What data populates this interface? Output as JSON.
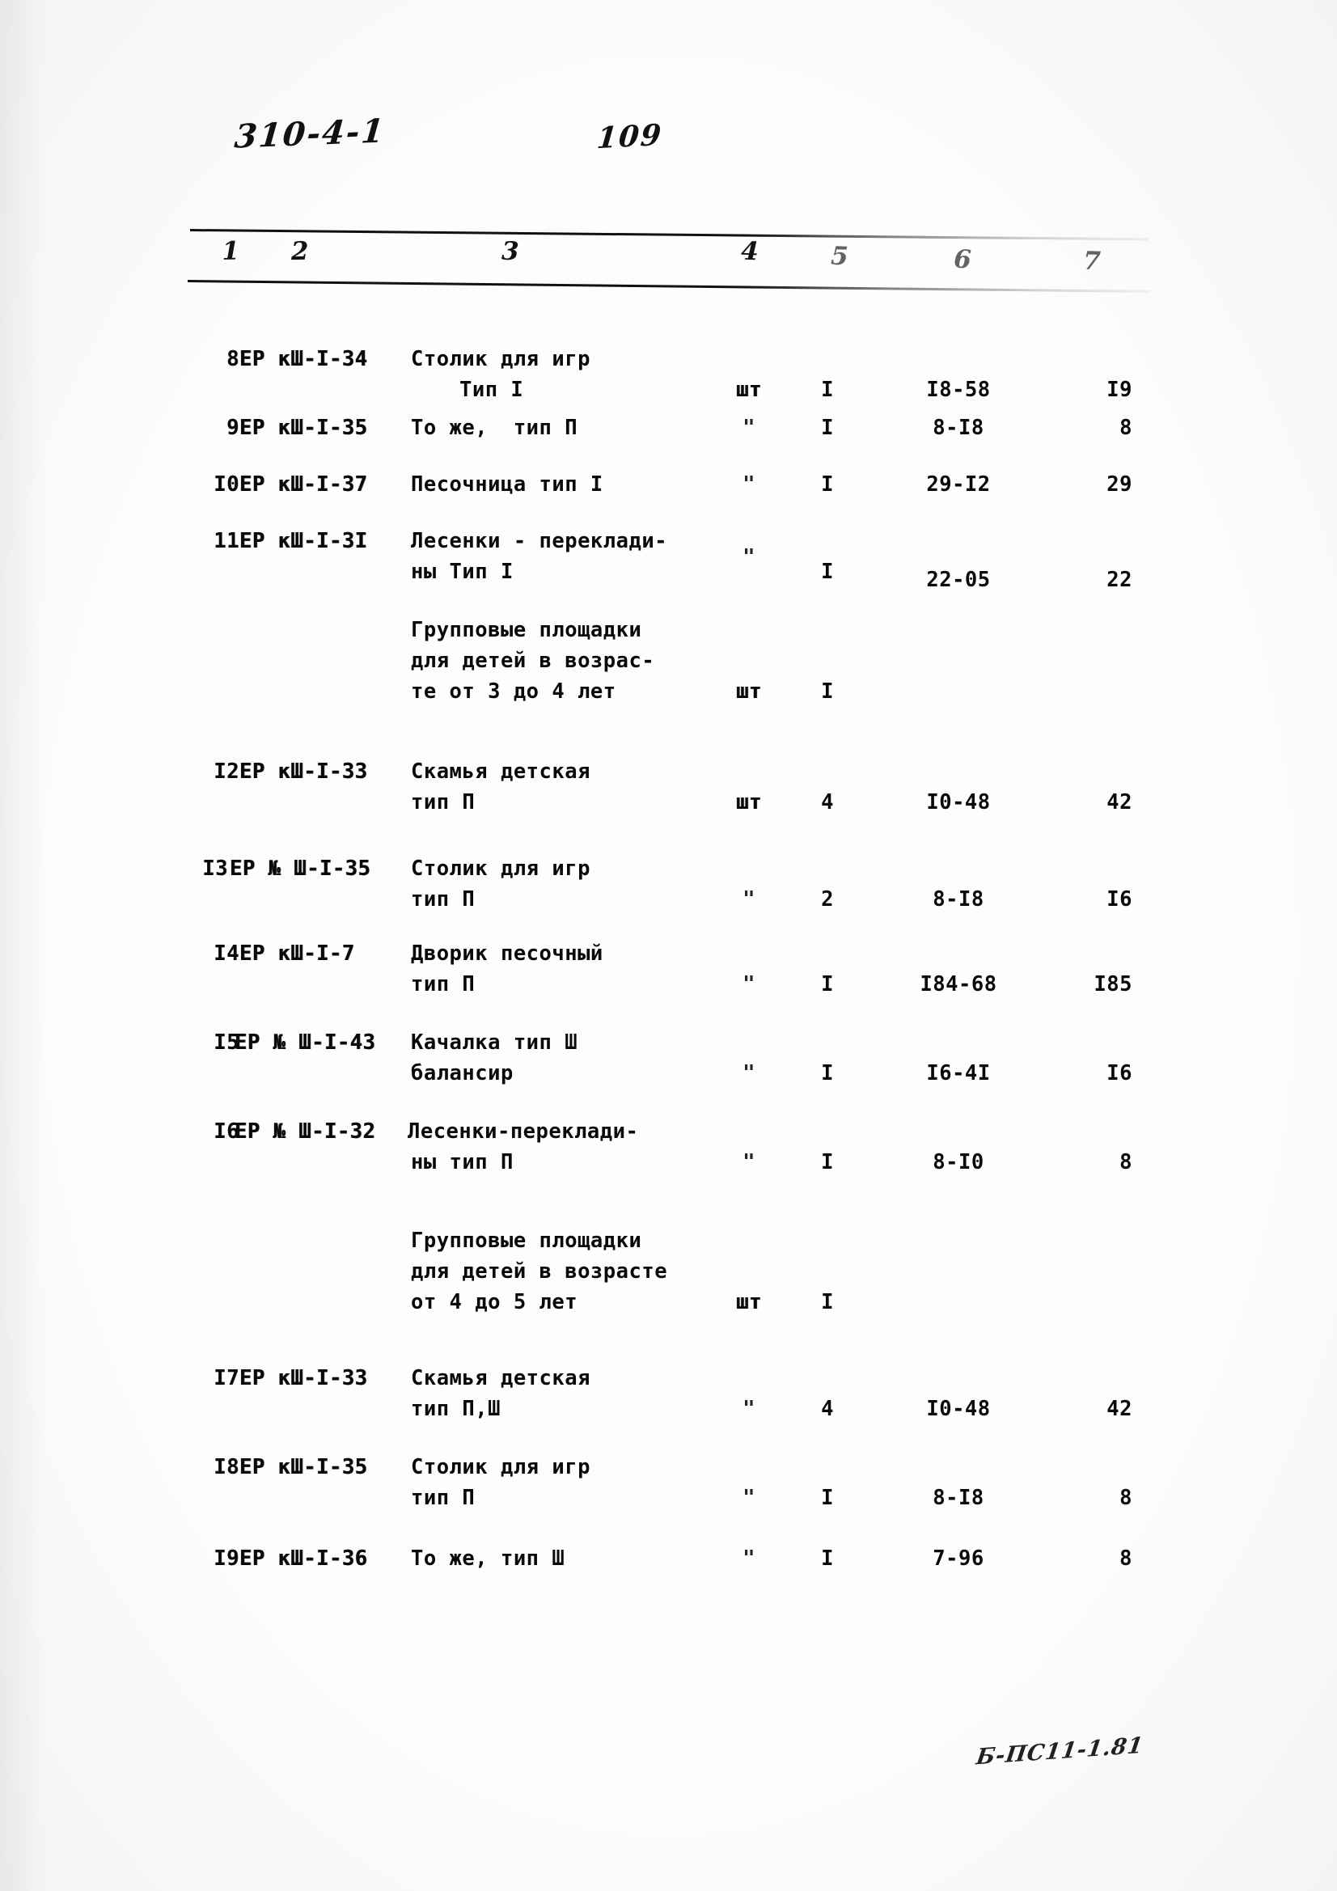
{
  "document": {
    "doc_code": "310-4-1",
    "page_number": "109",
    "bottom_mark": "Б-ПС11-1.81"
  },
  "table": {
    "column_numbers": [
      "1",
      "2",
      "3",
      "4",
      "5",
      "6",
      "7"
    ],
    "rows": [
      {
        "kind": "item",
        "no": "8",
        "code": "ЕР кШ-I-34",
        "name": "Столик для игр",
        "name2": "Тип I",
        "unit": "шт",
        "qty": "I",
        "price": "I8-58",
        "total": "I9"
      },
      {
        "kind": "item",
        "no": "9",
        "code": "ЕР кШ-I-35",
        "name": "То же,  тип П",
        "name2": "",
        "unit": "\"",
        "qty": "I",
        "price": "8-I8",
        "total": "8"
      },
      {
        "kind": "item",
        "no": "I0",
        "code": "ЕР кШ-I-37",
        "name": "Песочница тип I",
        "name2": "",
        "unit": "\"",
        "qty": "I",
        "price": "29-I2",
        "total": "29"
      },
      {
        "kind": "item",
        "no": "11",
        "code": "ЕР кШ-I-3I",
        "name": "Лесенки - переклади-",
        "name2": "ны Тип I",
        "unit": "\"",
        "qty": "I",
        "price": "22-05",
        "total": "22"
      },
      {
        "kind": "group",
        "no": "",
        "code": "",
        "name": "Групповые площадки",
        "name2": "для детей в возрас-",
        "name3": "те от 3 до 4 лет",
        "unit": "шт",
        "qty": "I",
        "price": "",
        "total": ""
      },
      {
        "kind": "item",
        "no": "I2",
        "code": "ЕР кШ-I-33",
        "name": "Скамья детская",
        "name2": "тип П",
        "unit": "шт",
        "qty": "4",
        "price": "I0-48",
        "total": "42"
      },
      {
        "kind": "item",
        "no": "I3",
        "code": "ЕР № Ш-I-35",
        "name": "Столик для игр",
        "name2": "тип П",
        "unit": "\"",
        "qty": "2",
        "price": "8-I8",
        "total": "I6"
      },
      {
        "kind": "item",
        "no": "I4",
        "code": "ЕР кШ-I-7",
        "name": "Дворик песочный",
        "name2": "тип П",
        "unit": "\"",
        "qty": "I",
        "price": "I84-68",
        "total": "I85"
      },
      {
        "kind": "item",
        "no": "I5",
        "code": "ЕР № Ш-I-43",
        "name": "Качалка тип Ш",
        "name2": "балансир",
        "unit": "\"",
        "qty": "I",
        "price": "I6-4I",
        "total": "I6"
      },
      {
        "kind": "item",
        "no": "I6",
        "code": "ЕР № Ш-I-32",
        "name": "Лесенки-переклади-",
        "name2": "ны тип П",
        "unit": "\"",
        "qty": "I",
        "price": "8-I0",
        "total": "8"
      },
      {
        "kind": "group",
        "no": "",
        "code": "",
        "name": "Групповые площадки",
        "name2": "для детей в возрасте",
        "name3": "от 4 до 5 лет",
        "unit": "шт",
        "qty": "I",
        "price": "",
        "total": ""
      },
      {
        "kind": "item",
        "no": "I7",
        "code": "ЕР кШ-I-33",
        "name": "Скамья детская",
        "name2": "тип П,Ш",
        "unit": "\"",
        "qty": "4",
        "price": "I0-48",
        "total": "42"
      },
      {
        "kind": "item",
        "no": "I8",
        "code": "ЕР кШ-I-35",
        "name": "Столик для игр",
        "name2": "тип П",
        "unit": "\"",
        "qty": "I",
        "price": "8-I8",
        "total": "8"
      },
      {
        "kind": "item",
        "no": "I9",
        "code": "ЕР кШ-I-36",
        "name": "То же, тип Ш",
        "name2": "",
        "unit": "\"",
        "qty": "I",
        "price": "7-96",
        "total": "8"
      }
    ]
  }
}
